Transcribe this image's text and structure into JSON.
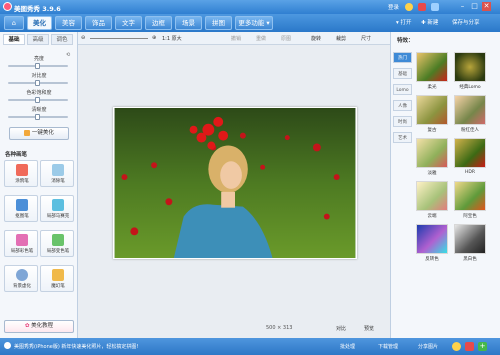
{
  "window": {
    "title": "美图秀秀 3.9.6",
    "login": "登录",
    "controls": [
      "–",
      "□",
      "✕"
    ]
  },
  "menu": {
    "tabs": [
      "美化",
      "美容",
      "饰品",
      "文字",
      "边框",
      "场景",
      "拼图",
      "更多功能 ▾"
    ],
    "open": "▾ 打开",
    "new": "✚ 新建",
    "save": "保存与分享"
  },
  "toolbar": {
    "zoom": "1:1 原大",
    "undo": "撤销",
    "redo": "重做",
    "original": "原图",
    "rotate": "旋转",
    "crop": "裁剪",
    "resize": "尺寸"
  },
  "left": {
    "tabs": [
      "基础",
      "高级",
      "调色"
    ],
    "sliders": [
      {
        "label": "亮度",
        "value": 0.5
      },
      {
        "label": "对比度",
        "value": 0.5
      },
      {
        "label": "色彩饱和度",
        "value": 0.5
      },
      {
        "label": "清晰度",
        "value": 0.5
      }
    ],
    "auto_button": "一键美化",
    "section_title": "各种画笔",
    "tools": [
      "涂鸦笔",
      "消除笔",
      "抠图笔",
      "局部马赛克",
      "局部彩色笔",
      "局部变色笔",
      "背景虚化",
      "魔幻笔"
    ],
    "tutorial": "美化教程"
  },
  "canvas": {
    "size": "500 × 313",
    "compare": "对比",
    "preview": "预览"
  },
  "right": {
    "title": "特效：",
    "tabs": [
      "热门",
      "基础",
      "Lomo",
      "人像",
      "时尚",
      "艺术"
    ],
    "effects": [
      "柔光",
      "经典Lomo",
      "复古",
      "粉红佳人",
      "淡雅",
      "HDR",
      "云端",
      "阿宝色",
      "反转色",
      "黑白色"
    ]
  },
  "status": {
    "left": "美图秀秀(iPhone版) 新年快速美化照片，轻松搞定拼图!",
    "batch": "批处理",
    "download": "下载管理",
    "share": "分享图片"
  }
}
